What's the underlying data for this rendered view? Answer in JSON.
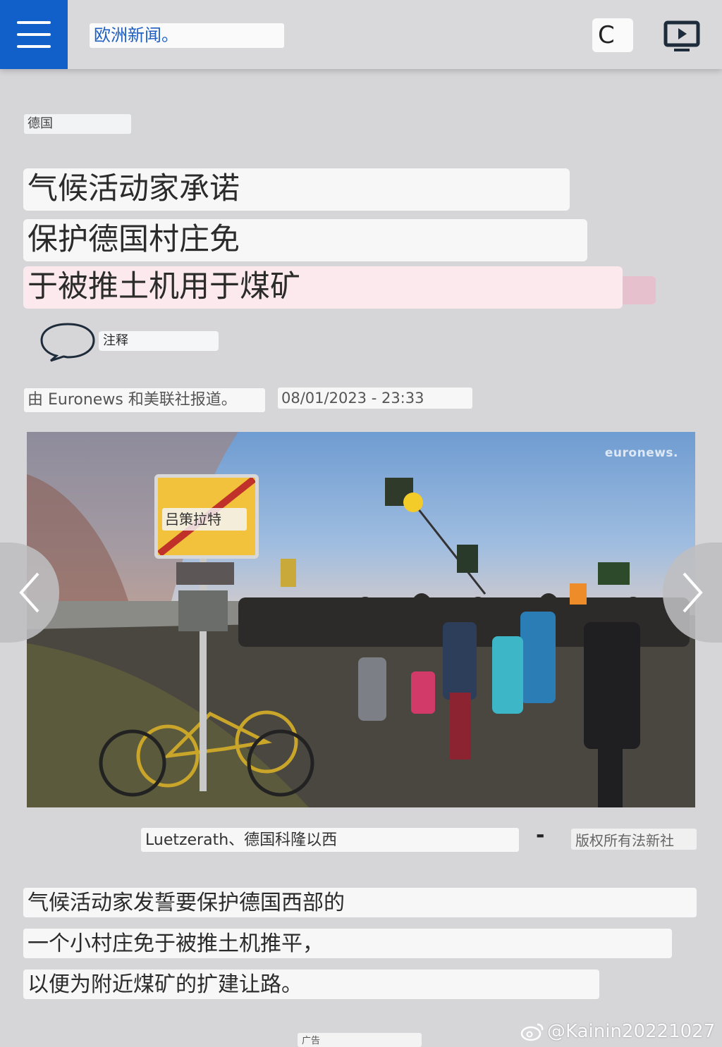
{
  "header": {
    "brand": "欧洲新闻。",
    "live_label": "C",
    "menu_icon": "hamburger-menu-icon",
    "tv_icon": "tv-play-icon"
  },
  "article": {
    "category": "德国",
    "headline_lines": [
      "气候活动家承诺",
      "保护德国村庄免",
      "于被推土机用于煤矿"
    ],
    "comments_label": "注释",
    "byline": "由 Euronews 和美联社报道。",
    "date": "08/01/2023 - 23:33",
    "image": {
      "watermark": "euronews.",
      "sign_text": "吕策拉特",
      "caption": "Luetzerath、德国科隆以西",
      "separator": "-",
      "credit": "版权所有法新社"
    },
    "body_lines": [
      "气候活动家发誓要保护德国西部的",
      "一个小村庄免于被推土机推平，",
      "以便为附近煤矿的扩建让路。"
    ],
    "ad_label": "广告"
  },
  "source_mark": "@Kainin20221027",
  "colors": {
    "brand_blue": "#1160c9",
    "background": "#d6d6d8",
    "highlight_pink": "#fbe9ee"
  }
}
